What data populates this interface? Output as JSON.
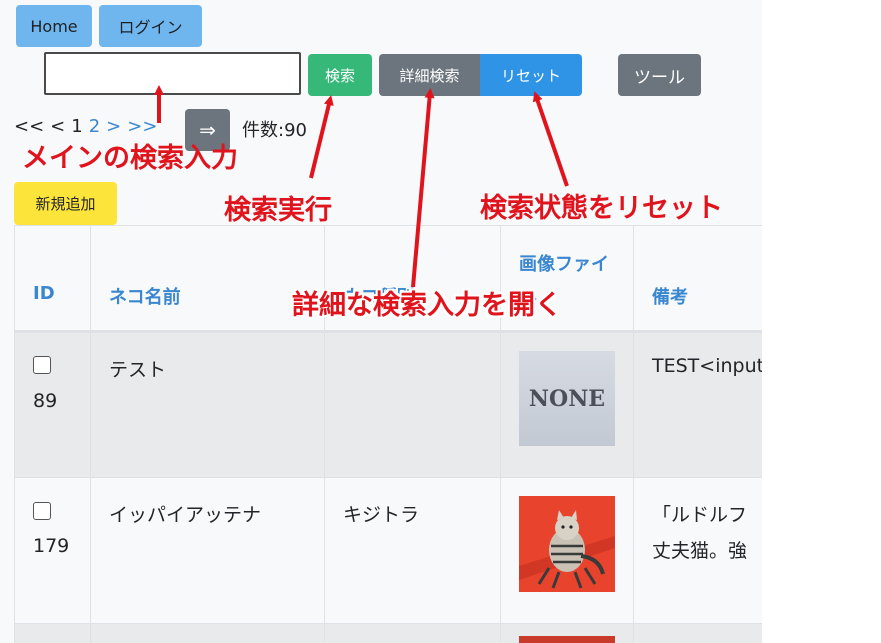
{
  "nav": {
    "home_label": "Home",
    "login_label": "ログイン"
  },
  "search": {
    "value": "",
    "placeholder": "",
    "search_label": "検索",
    "detail_label": "詳細検索",
    "reset_label": "リセット",
    "tool_label": "ツール"
  },
  "pager": {
    "first": "<<",
    "prev": "<",
    "pages": [
      "1",
      "2"
    ],
    "next": ">",
    "last": ">>",
    "go_label": "⇒",
    "count": "件数:90"
  },
  "actions": {
    "new_label": "新規追加"
  },
  "table": {
    "headers": [
      "ID",
      "ネコ名前",
      "ネコ種別",
      "画像ファイル",
      "備考"
    ],
    "rows": [
      {
        "id": "89",
        "name": "テスト",
        "kind": "",
        "image_text": "NONE",
        "note": "TEST<input"
      },
      {
        "id": "179",
        "name": "イッパイアッテナ",
        "kind": "キジトラ",
        "image_text": "",
        "note_line1": "「ルドルフ",
        "note_line2": "丈夫猫。強"
      }
    ]
  },
  "annotations": {
    "main_search": "メインの検索入力",
    "run_search": "検索実行",
    "reset_state": "検索状態をリセット",
    "open_detail": "詳細な検索入力を開く"
  },
  "colors": {
    "annotation": "#e0141d",
    "link": "#3a87d0",
    "green": "#36b878",
    "blue": "#2f93e6",
    "gray": "#6c757d",
    "yellow": "#fde43a"
  }
}
